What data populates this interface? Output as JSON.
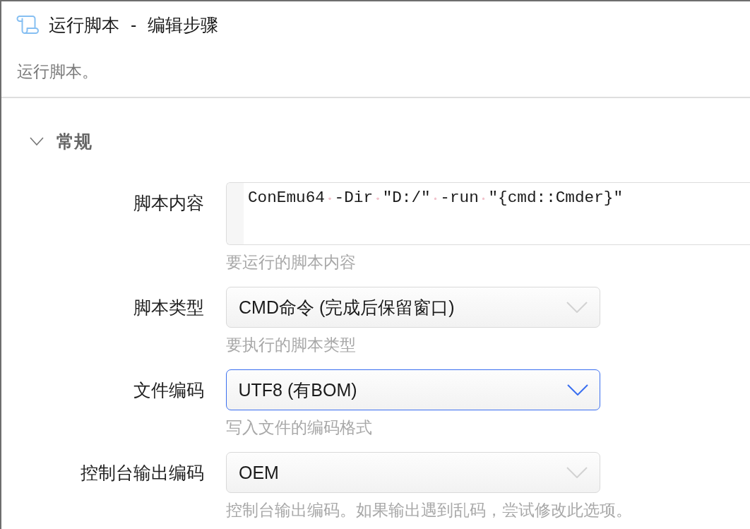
{
  "window": {
    "title": "运行脚本 - 编辑步骤",
    "description": "运行脚本。"
  },
  "section": {
    "title": "常规",
    "expanded": true,
    "fields": [
      {
        "kind": "code",
        "label": "脚本内容",
        "value": "ConEmu64 -Dir \"D:/\" -run \"{cmd::Cmder}\"",
        "focused": false,
        "hint": "要运行的脚本内容"
      },
      {
        "kind": "select",
        "label": "脚本类型",
        "value": "CMD命令 (完成后保留窗口)",
        "focused": false,
        "hint": "要执行的脚本类型"
      },
      {
        "kind": "select",
        "label": "文件编码",
        "value": "UTF8 (有BOM)",
        "focused": true,
        "hint": "写入文件的编码格式"
      },
      {
        "kind": "select",
        "label": "控制台输出编码",
        "value": "OEM",
        "focused": false,
        "hint": "控制台输出编码。如果输出遇到乱码，尝试修改此选项。"
      }
    ]
  }
}
